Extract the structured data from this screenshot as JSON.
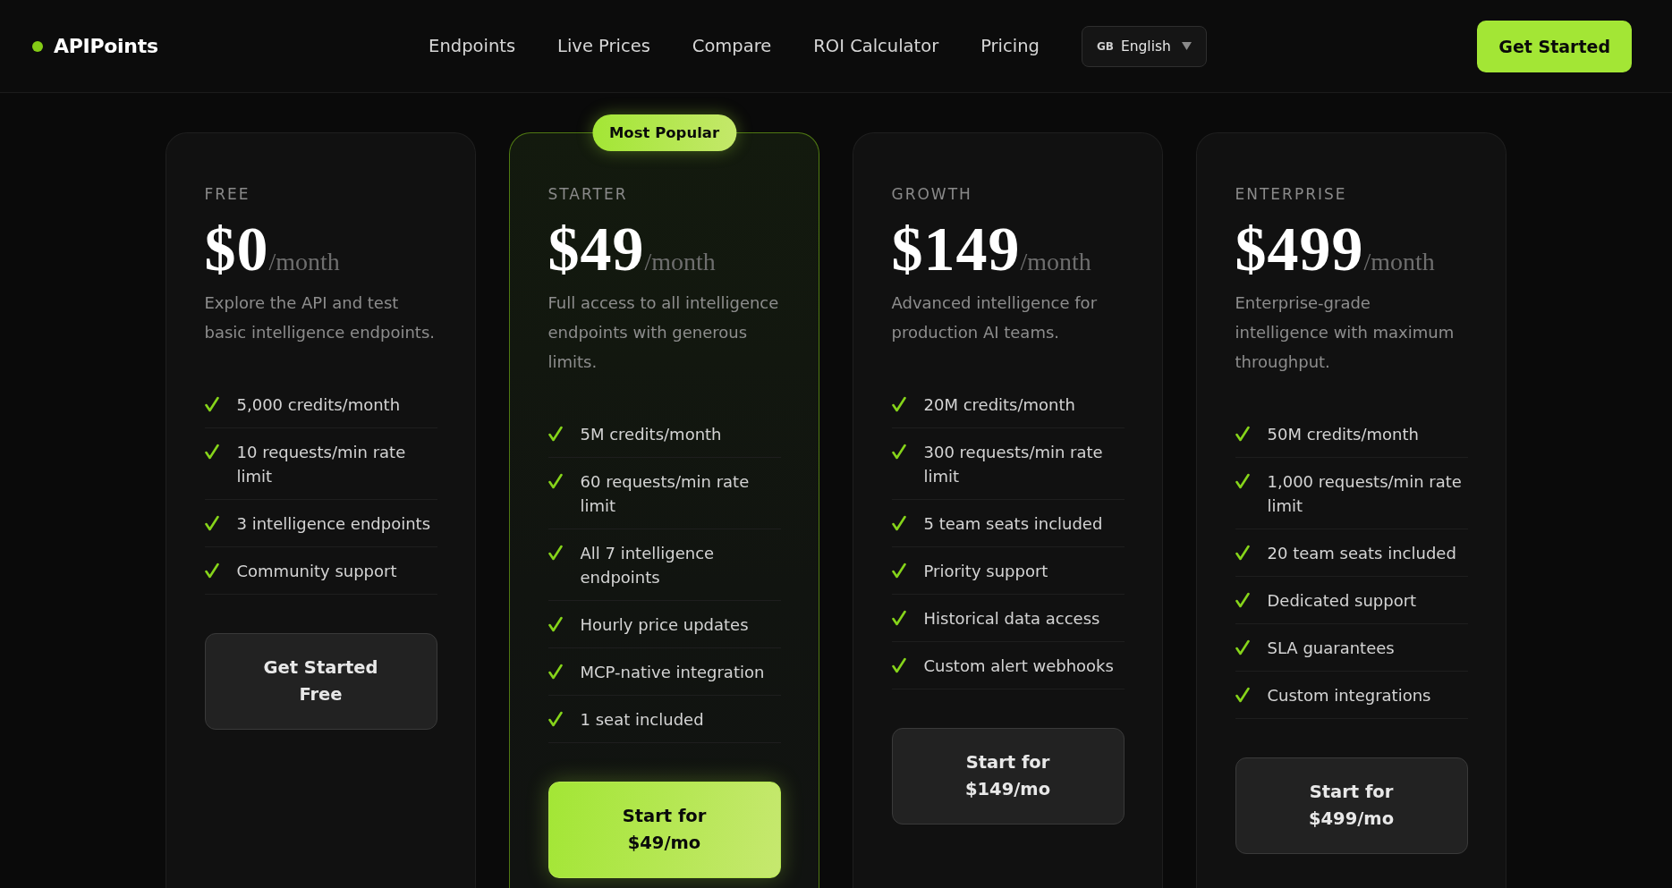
{
  "header": {
    "brand": "APIPoints",
    "nav": [
      "Endpoints",
      "Live Prices",
      "Compare",
      "ROI Calculator",
      "Pricing"
    ],
    "language": {
      "flag": "GB",
      "label": "English"
    },
    "cta": "Get Started"
  },
  "plans": [
    {
      "tier": "FREE",
      "price": "$0",
      "period": "/month",
      "description": "Explore the API and test basic intelligence endpoints.",
      "features": [
        "5,000 credits/month",
        "10 requests/min rate limit",
        "3 intelligence endpoints",
        "Community support"
      ],
      "button": "Get Started Free",
      "featured": false
    },
    {
      "badge": "Most Popular",
      "tier": "STARTER",
      "price": "$49",
      "period": "/month",
      "description": "Full access to all intelligence endpoints with generous limits.",
      "features": [
        "5M credits/month",
        "60 requests/min rate limit",
        "All 7 intelligence endpoints",
        "Hourly price updates",
        "MCP-native integration",
        "1 seat included"
      ],
      "button": "Start for $49/mo",
      "featured": true
    },
    {
      "tier": "GROWTH",
      "price": "$149",
      "period": "/month",
      "description": "Advanced intelligence for production AI teams.",
      "features": [
        "20M credits/month",
        "300 requests/min rate limit",
        "5 team seats included",
        "Priority support",
        "Historical data access",
        "Custom alert webhooks"
      ],
      "button": "Start for $149/mo",
      "featured": false
    },
    {
      "tier": "ENTERPRISE",
      "price": "$499",
      "period": "/month",
      "description": "Enterprise-grade intelligence with maximum throughput.",
      "features": [
        "50M credits/month",
        "1,000 requests/min rate limit",
        "20 team seats included",
        "Dedicated support",
        "SLA guarantees",
        "Custom integrations"
      ],
      "button": "Start for $499/mo",
      "featured": false
    }
  ]
}
